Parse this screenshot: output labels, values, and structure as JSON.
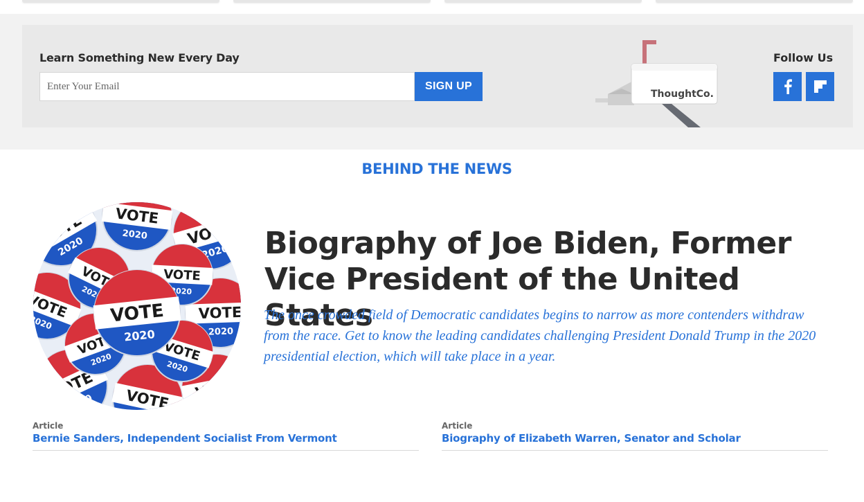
{
  "newsletter": {
    "heading": "Learn Something New Every Day",
    "email_placeholder": "Enter Your Email",
    "signup_label": "SIGN UP",
    "mailbox_brand": "ThoughtCo."
  },
  "follow": {
    "heading": "Follow Us",
    "icons": [
      "facebook-icon",
      "flipboard-icon"
    ]
  },
  "section": {
    "title": "BEHIND THE NEWS"
  },
  "feature": {
    "title": "Biography of Joe Biden, Former Vice President of the United States",
    "description": "The once crowded field of Democratic candidates begins to narrow as more contenders withdraw from the race. Get to know the leading candidates challenging President Donald Trump in the 2020 presidential election, which will take place in a year.",
    "image_button_words": [
      "VOTE",
      "2020"
    ]
  },
  "related": [
    {
      "type": "Article",
      "title": "Bernie Sanders, Independent Socialist From Vermont"
    },
    {
      "type": "Article",
      "title": "Biography of Elizabeth Warren, Senator and Scholar"
    }
  ],
  "colors": {
    "accent": "#2872d8",
    "band": "#f2f2f2",
    "newsletter_bg": "#e9e9e9",
    "heading_text": "#2b2b2b"
  }
}
